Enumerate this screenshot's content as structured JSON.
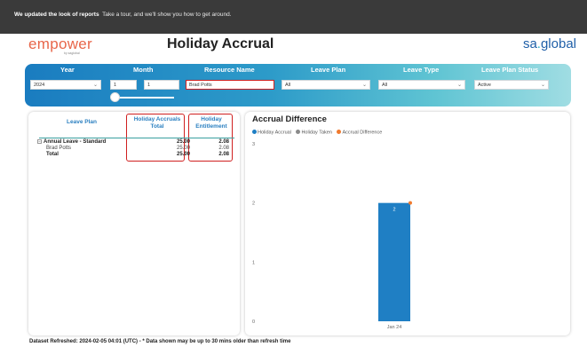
{
  "banner": {
    "bold": "We updated the look of reports",
    "rest": "Take a tour, and we'll show you how to get around."
  },
  "header": {
    "logo": "empower",
    "logo_sub": "by saglobal",
    "title": "Holiday Accrual",
    "brand_left": "sa",
    "brand_dot": ".",
    "brand_right": "global"
  },
  "filters": {
    "year": {
      "label": "Year",
      "value": "2024"
    },
    "month": {
      "label": "Month",
      "from": "1",
      "to": "1"
    },
    "resource_name": {
      "label": "Resource Name",
      "value": "Brad Potts"
    },
    "leave_plan": {
      "label": "Leave Plan",
      "value": "All"
    },
    "leave_type": {
      "label": "Leave Type",
      "value": "All"
    },
    "leave_plan_status": {
      "label": "Leave Plan Status",
      "value": "Active"
    }
  },
  "table": {
    "headers": {
      "leave_plan": "Leave Plan",
      "accruals": "Holiday Accruals Total",
      "entitlement": "Holiday Entitlement"
    },
    "rows": [
      {
        "name": "Annual Leave - Standard",
        "accruals": "25.00",
        "entitlement": "2.08",
        "bold": true
      },
      {
        "name": "Brad Potts",
        "accruals": "25.00",
        "entitlement": "2.08",
        "bold": false
      },
      {
        "name": "Total",
        "accruals": "25.00",
        "entitlement": "2.08",
        "bold": true
      }
    ]
  },
  "chart": {
    "title": "Accrual Difference",
    "legend": [
      {
        "name": "Holiday Accrual",
        "color": "#1f7fc4"
      },
      {
        "name": "Holiday Taken",
        "color": "#8a8a8a"
      },
      {
        "name": "Accrual Difference",
        "color": "#f07a2e"
      }
    ]
  },
  "chart_data": {
    "type": "bar",
    "title": "Accrual Difference",
    "categories": [
      "Jan 24"
    ],
    "series": [
      {
        "name": "Holiday Accrual",
        "values": [
          2
        ],
        "color": "#1f7fc4"
      },
      {
        "name": "Holiday Taken",
        "values": [
          0
        ],
        "color": "#8a8a8a"
      },
      {
        "name": "Accrual Difference",
        "values": [
          2
        ],
        "color": "#f07a2e"
      }
    ],
    "data_labels": [
      "2"
    ],
    "yticks": [
      0,
      1,
      2,
      3
    ],
    "ylim": [
      0,
      3
    ],
    "grid": false,
    "legend_position": "top-left"
  },
  "footer": "Dataset Refreshed: 2024-02-05 04:01 (UTC) - * Data shown may be up to 30 mins older than refresh time",
  "icons": {
    "dropdown": "chevron-down-icon",
    "collapse": "minus-icon",
    "slider": "slider-knob"
  }
}
